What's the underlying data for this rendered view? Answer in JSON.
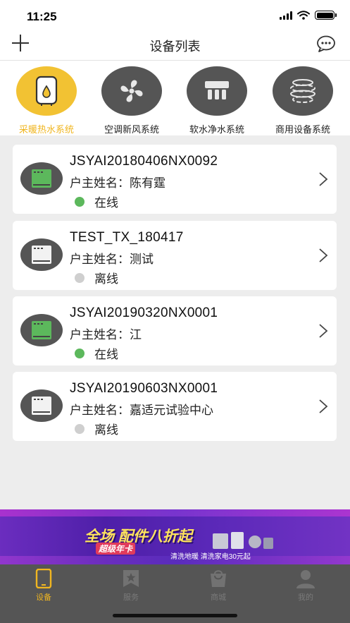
{
  "status_bar": {
    "time": "11:25"
  },
  "nav": {
    "title": "设备列表"
  },
  "categories": [
    {
      "label": "采暖热水系统",
      "icon": "water-heater-icon",
      "active": true
    },
    {
      "label": "空调新风系统",
      "icon": "fan-icon",
      "active": false
    },
    {
      "label": "软水净水系统",
      "icon": "water-purifier-icon",
      "active": false
    },
    {
      "label": "商用设备系统",
      "icon": "commercial-device-icon",
      "active": false
    }
  ],
  "devices": [
    {
      "serial": "JSYAI20180406NX0092",
      "owner": "户主姓名：陈有霆",
      "status": "在线",
      "online": true
    },
    {
      "serial": "TEST_TX_180417",
      "owner": "户主姓名：测试",
      "status": "离线",
      "online": false
    },
    {
      "serial": "JSYAI20190320NX0001",
      "owner": "户主姓名：江",
      "status": "在线",
      "online": true
    },
    {
      "serial": "JSYAI20190603NX0001",
      "owner": "户主姓名：嘉适元试验中心",
      "status": "离线",
      "online": false
    }
  ],
  "banner": {
    "title": "全场 配件八折起",
    "subtitle": "超级年卡",
    "note": "清洗地暖 清洗家电30元起"
  },
  "tabs": [
    {
      "label": "设备",
      "icon": "phone-icon",
      "active": true
    },
    {
      "label": "服务",
      "icon": "service-star-icon",
      "active": false
    },
    {
      "label": "商城",
      "icon": "shopping-bag-icon",
      "active": false
    },
    {
      "label": "我的",
      "icon": "user-icon",
      "active": false
    }
  ],
  "colors": {
    "accent": "#f0b620",
    "online": "#5cb85c",
    "offline": "#cfcfcf",
    "icon_bg": "#555555",
    "background": "#ededed"
  }
}
